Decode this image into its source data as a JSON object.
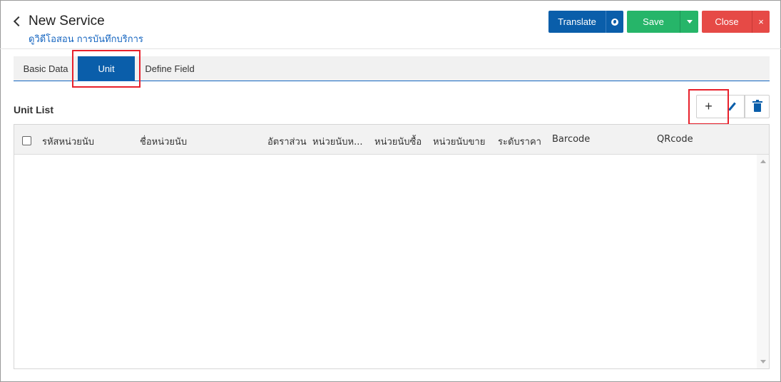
{
  "header": {
    "title": "New Service",
    "subtitle": "ดูวิดีโอสอน การบันทึกบริการ",
    "buttons": {
      "translate": "Translate",
      "save": "Save",
      "close": "Close",
      "close_x": "×"
    }
  },
  "tabs": [
    {
      "label": "Basic Data",
      "active": false
    },
    {
      "label": "Unit",
      "active": true
    },
    {
      "label": "Define Field",
      "active": false
    }
  ],
  "section": {
    "title": "Unit List",
    "add_label": "+"
  },
  "table": {
    "columns": [
      "รหัสหน่วยนับ",
      "ชื่อหน่วยนับ",
      "อัตราส่วน",
      "หน่วยนับห...",
      "หน่วยนับซื้อ",
      "หน่วยนับขาย",
      "ระดับราคา",
      "Barcode",
      "QRcode"
    ],
    "rows": []
  },
  "icons": {
    "back": "chevron-left-icon",
    "translate": "globe-icon",
    "save_menu": "caret-down-icon",
    "edit": "pencil-icon",
    "delete": "trash-icon"
  },
  "colors": {
    "primary": "#0a5eaa",
    "success": "#26b569",
    "danger": "#e64a46",
    "highlight": "#e8212c",
    "link": "#1565c0"
  }
}
